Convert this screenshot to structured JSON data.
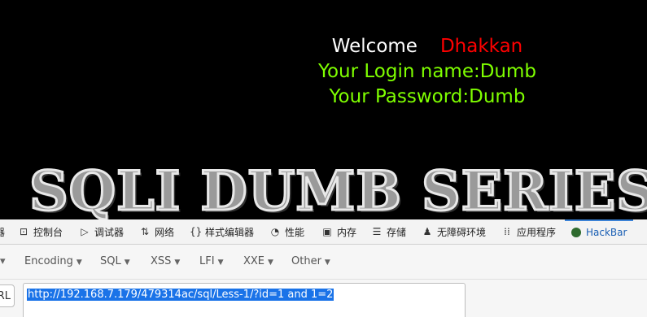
{
  "page": {
    "welcome_word": "Welcome",
    "user_name": "Dhakkan",
    "login_name_line": "Your Login name:Dumb",
    "password_line": "Your Password:Dumb",
    "banner": "SQLI DUMB SERIES"
  },
  "devtools": {
    "tabs": [
      {
        "icon": "elements-icon",
        "label": "器"
      },
      {
        "icon": "console-icon",
        "label": "控制台"
      },
      {
        "icon": "debugger-icon",
        "label": "调试器"
      },
      {
        "icon": "network-icon",
        "label": "网络"
      },
      {
        "icon": "style-editor-icon",
        "label": "样式编辑器"
      },
      {
        "icon": "performance-icon",
        "label": "性能"
      },
      {
        "icon": "memory-icon",
        "label": "内存"
      },
      {
        "icon": "storage-icon",
        "label": "存储"
      },
      {
        "icon": "accessibility-icon",
        "label": "无障碍环境"
      },
      {
        "icon": "application-icon",
        "label": "应用程序"
      },
      {
        "icon": "hackbar-icon",
        "label": "HackBar"
      }
    ],
    "active_tab": "HackBar"
  },
  "hackbar": {
    "menus": [
      "Encoding",
      "SQL",
      "XSS",
      "LFI",
      "XXE",
      "Other"
    ],
    "side_button": "RL",
    "url_value": "http://192.168.7.179/479314ac/sql/Less-1/?id=1 and 1=2"
  },
  "colors": {
    "welcome": "#ffffff",
    "user_name": "#ff0000",
    "info_text": "#7fff00",
    "selection": "#1a73e8",
    "active_tab_border": "#3b82d6"
  }
}
